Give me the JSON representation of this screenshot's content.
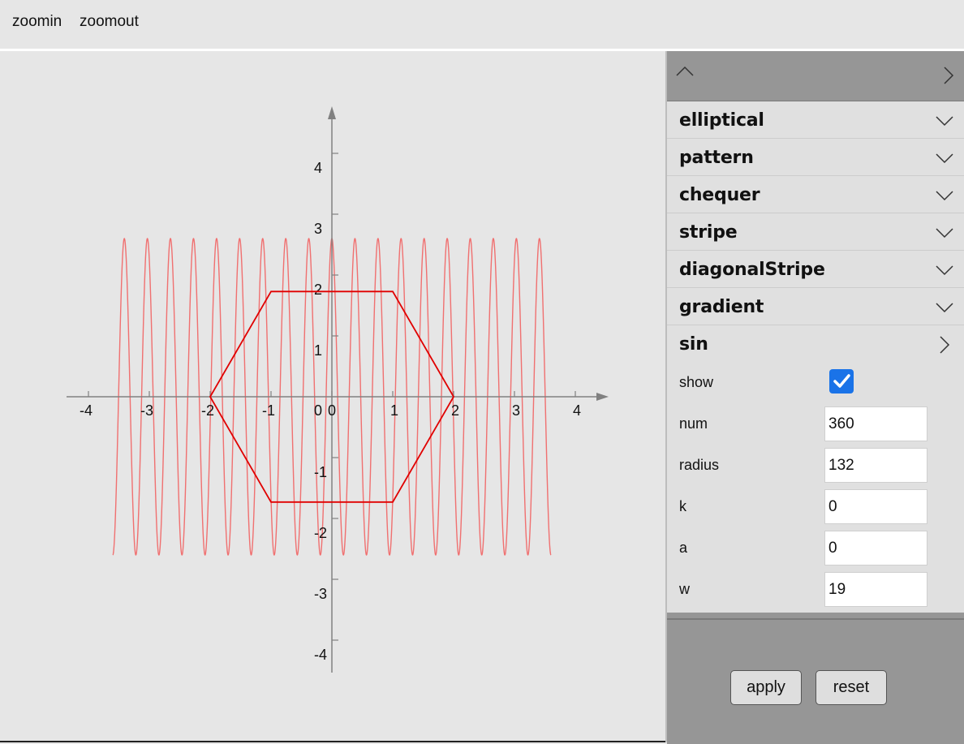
{
  "toolbar": {
    "zoomin_label": "zoomin",
    "zoomout_label": "zoomout"
  },
  "panel": {
    "sections": [
      {
        "label": "elliptical",
        "expanded": false
      },
      {
        "label": "pattern",
        "expanded": false
      },
      {
        "label": "chequer",
        "expanded": false
      },
      {
        "label": "stripe",
        "expanded": false
      },
      {
        "label": "diagonalStripe",
        "expanded": false
      },
      {
        "label": "gradient",
        "expanded": false
      },
      {
        "label": "sin",
        "expanded": true
      }
    ],
    "sin": {
      "show_label": "show",
      "show_checked": true,
      "fields": [
        {
          "label": "num",
          "value": "360"
        },
        {
          "label": "radius",
          "value": "132"
        },
        {
          "label": "k",
          "value": "0"
        },
        {
          "label": "a",
          "value": "0"
        },
        {
          "label": "w",
          "value": "19"
        }
      ]
    },
    "footer": {
      "apply_label": "apply",
      "reset_label": "reset"
    }
  },
  "colors": {
    "sine": "#f07070",
    "hexagon": "#e00000",
    "axes": "#808080",
    "checkbox": "#1a73e8"
  },
  "chart_data": {
    "type": "line",
    "x_ticks": [
      "-4",
      "-3",
      "-2",
      "-1",
      "0",
      "1",
      "2",
      "3",
      "4"
    ],
    "y_ticks": [
      "4",
      "3",
      "2",
      "1",
      "0",
      "-1",
      "-2",
      "-3",
      "-4"
    ],
    "xlim": [
      -4,
      4
    ],
    "ylim": [
      -4,
      4
    ],
    "series": [
      {
        "kind": "sine",
        "x_range": [
          -3.6,
          3.6
        ],
        "y_max": 2.6,
        "y_min": -2.6,
        "cycles": 19
      },
      {
        "kind": "polygon",
        "points": [
          [
            -1,
            1.73
          ],
          [
            1,
            1.73
          ],
          [
            2,
            0
          ],
          [
            1,
            -1.73
          ],
          [
            -1,
            -1.73
          ],
          [
            -2,
            0
          ]
        ]
      }
    ]
  }
}
